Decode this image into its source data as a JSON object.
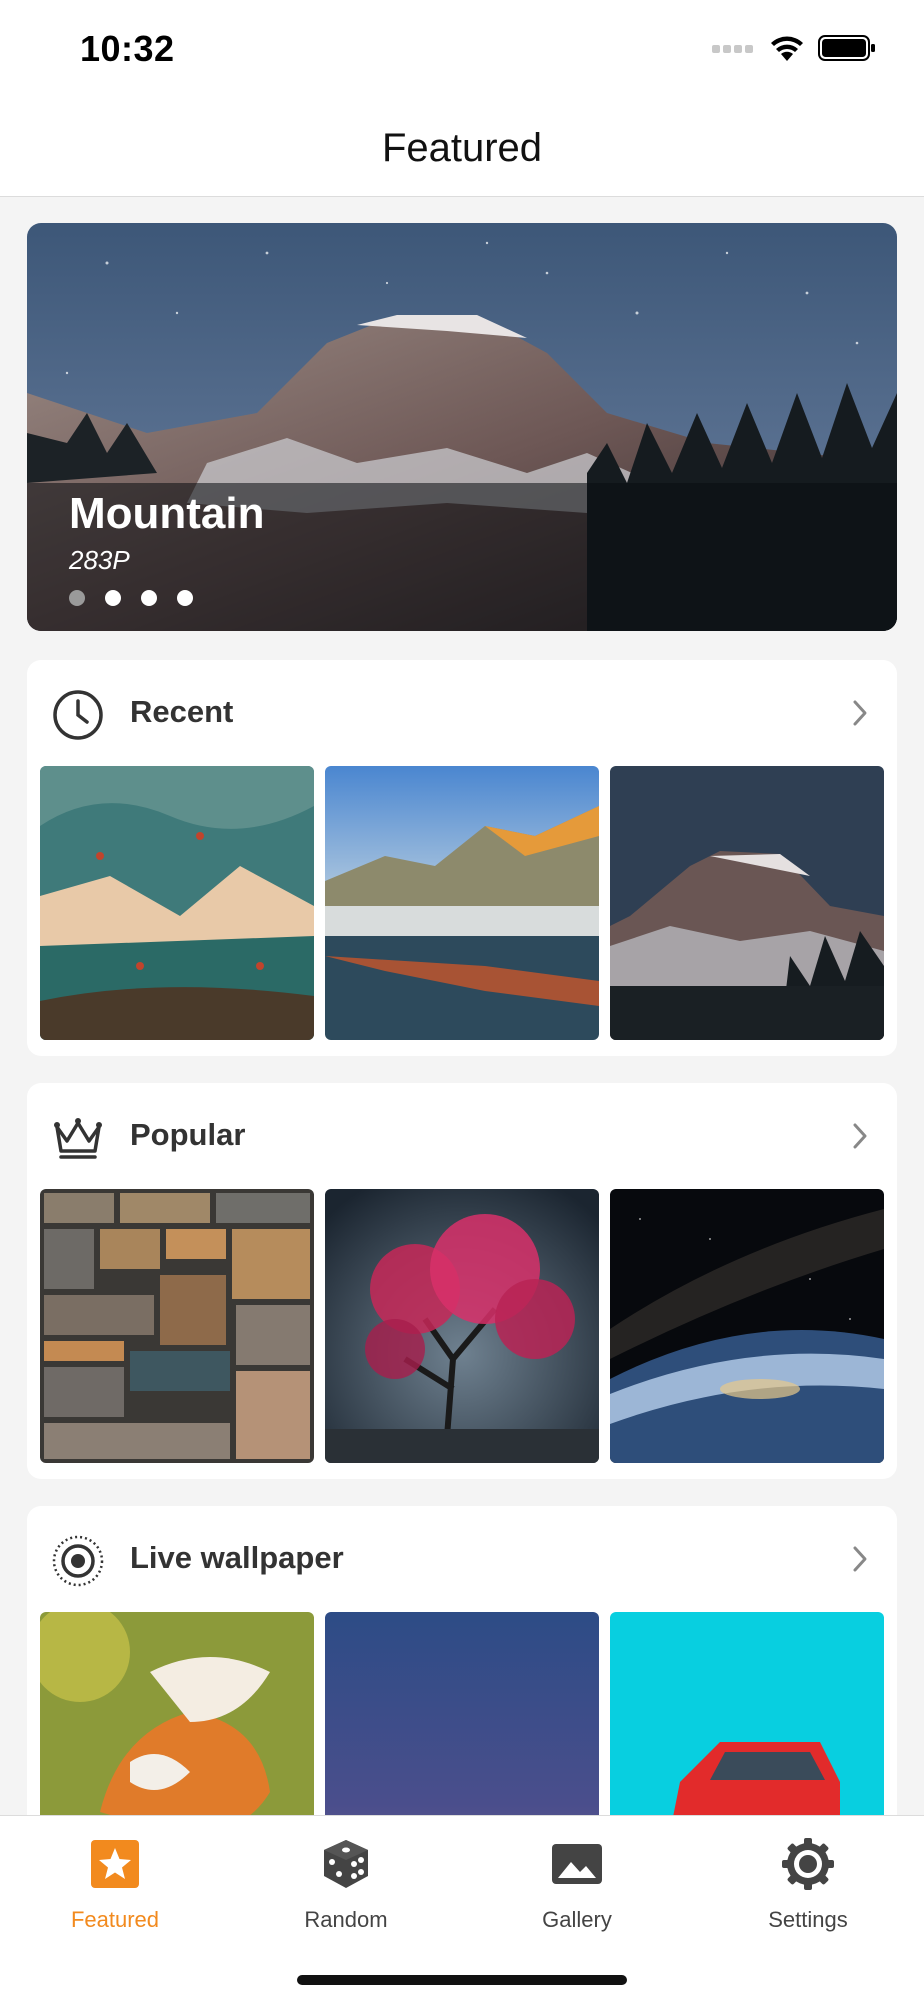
{
  "status_bar": {
    "time": "10:32"
  },
  "nav": {
    "title": "Featured"
  },
  "hero": {
    "title": "Mountain",
    "subtitle": "283P",
    "dots": 4,
    "active_dot": 0
  },
  "sections": [
    {
      "title": "Recent",
      "icon": "clock-icon",
      "thumbs": [
        "autumn-mountain-painting",
        "mountain-lake-reflection",
        "half-dome-night"
      ]
    },
    {
      "title": "Popular",
      "icon": "crown-icon",
      "thumbs": [
        "stone-wall",
        "red-tree",
        "earth-from-space"
      ]
    },
    {
      "title": "Live wallpaper",
      "icon": "live-photo-icon",
      "thumbs": [
        "fox-painting",
        "girl-twilight",
        "red-car"
      ]
    }
  ],
  "tabs": [
    {
      "label": "Featured",
      "icon": "star-icon",
      "active": true
    },
    {
      "label": "Random",
      "icon": "dice-icon",
      "active": false
    },
    {
      "label": "Gallery",
      "icon": "photo-icon",
      "active": false
    },
    {
      "label": "Settings",
      "icon": "gear-icon",
      "active": false
    }
  ],
  "colors": {
    "accent": "#f28a1e",
    "background": "#f4f4f4",
    "card": "#ffffff"
  }
}
